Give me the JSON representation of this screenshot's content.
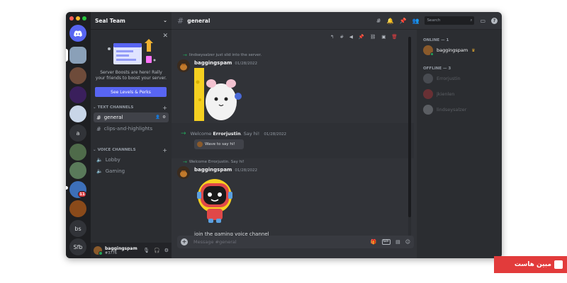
{
  "server": {
    "name": "Seal Team",
    "rail": [
      {
        "kind": "home",
        "label": ""
      },
      {
        "kind": "avatar",
        "label": "",
        "color": "#8aa0b8",
        "active": true
      },
      {
        "kind": "avatar",
        "label": "",
        "color": "#6e4b3a"
      },
      {
        "kind": "avatar",
        "label": "",
        "color": "#3a1f5c"
      },
      {
        "kind": "avatar",
        "label": "",
        "color": "#c9d6e8"
      },
      {
        "kind": "text",
        "label": "a"
      },
      {
        "kind": "avatar",
        "label": "",
        "color": "#4f6b4a"
      },
      {
        "kind": "avatar",
        "label": "",
        "color": "#5a7a5a"
      },
      {
        "kind": "avatar",
        "label": "",
        "color": "#3d6fb8",
        "badge": "11"
      },
      {
        "kind": "avatar",
        "label": "",
        "color": "#8a4a1a"
      },
      {
        "kind": "text",
        "label": "bs"
      },
      {
        "kind": "text",
        "label": "Sfb"
      }
    ]
  },
  "boost": {
    "text": "Server Boosts are here! Rally your friends to boost your server.",
    "button": "See Levels & Perks"
  },
  "categories": {
    "text": "TEXT CHANNELS",
    "voice": "VOICE CHANNELS"
  },
  "channels": {
    "general": "general",
    "clips": "clips-and-highlights",
    "lobby": "Lobby",
    "gaming": "Gaming"
  },
  "user": {
    "name": "baggingspam",
    "tag": "#3776"
  },
  "topbar": {
    "channel": "general",
    "search_placeholder": "Search"
  },
  "messages": {
    "sys1": "lindseysalzer just slid into the server.",
    "msg1_author": "baggingspam",
    "msg1_time": "01/28/2022",
    "welcome_prefix": "Welcome ",
    "welcome_name": "Errorjustin",
    "welcome_suffix": ". Say hi!",
    "welcome_time": "01/28/2022",
    "wave_button": "Wave to say hi!",
    "sys2": "Welcome Errorjustin. Say hi!",
    "msg2_author": "baggingspam",
    "msg2_time": "01/28/2022",
    "msg2_text": "join the gaming voice channel"
  },
  "composer": {
    "placeholder": "Message #general",
    "gif_label": "GIF"
  },
  "members": {
    "online_header": "ONLINE — 1",
    "offline_header": "OFFLINE — 3",
    "online": [
      {
        "name": "baggingspam",
        "color": "#8a5a2b"
      }
    ],
    "offline": [
      {
        "name": "Errorjustin",
        "color": "#80848e"
      },
      {
        "name": "jkienlen",
        "color": "#da373c"
      },
      {
        "name": "lindseysalzer",
        "color": "#b5bac1"
      }
    ]
  },
  "watermark": {
    "text": "مبین هاست"
  },
  "colors": {
    "blurple": "#5865f2",
    "online": "#23a55a",
    "danger": "#f23f42"
  }
}
